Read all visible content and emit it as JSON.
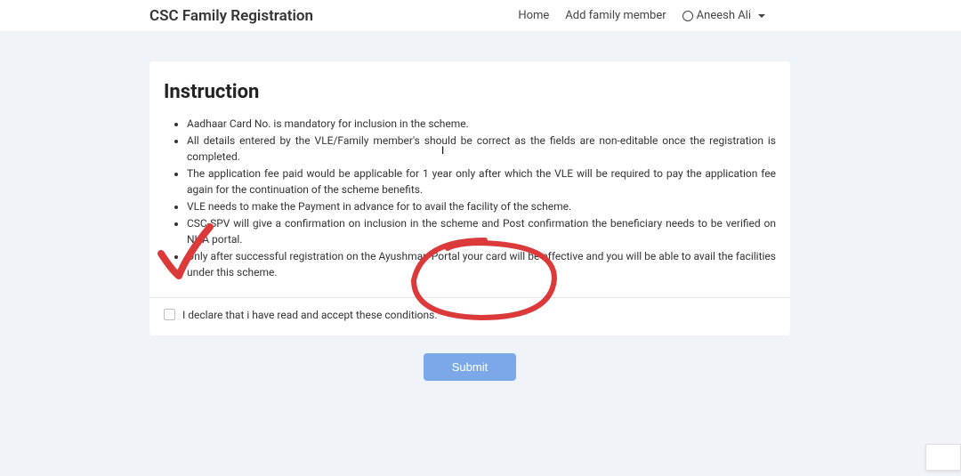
{
  "nav": {
    "brand": "CSC Family Registration",
    "home": "Home",
    "add_member": "Add family member",
    "user_name": "Aneesh Ali"
  },
  "card": {
    "title": "Instruction",
    "bullets": [
      "Aadhaar Card No. is mandatory for inclusion in the scheme.",
      "All details entered by the VLE/Family member's should be correct as the fields are non-editable once the registration is completed.",
      "The application fee paid would be applicable for 1 year only after which the VLE will be required to pay the application fee again for the continuation of the scheme benefits.",
      "VLE needs to make the Payment in advance for to avail the facility of the scheme.",
      "CSC-SPV will give a confirmation on inclusion in the scheme and Post confirmation the beneficiary needs to be verified on NHA portal.",
      "Only after successful registration on the Ayushman Portal your card will be effective and you will be able to avail the facilities under this scheme."
    ],
    "declare_label": "I declare that i have read and accept these conditions.",
    "submit_label": "Submit"
  },
  "annotation": {
    "color": "#dc3a3a"
  }
}
